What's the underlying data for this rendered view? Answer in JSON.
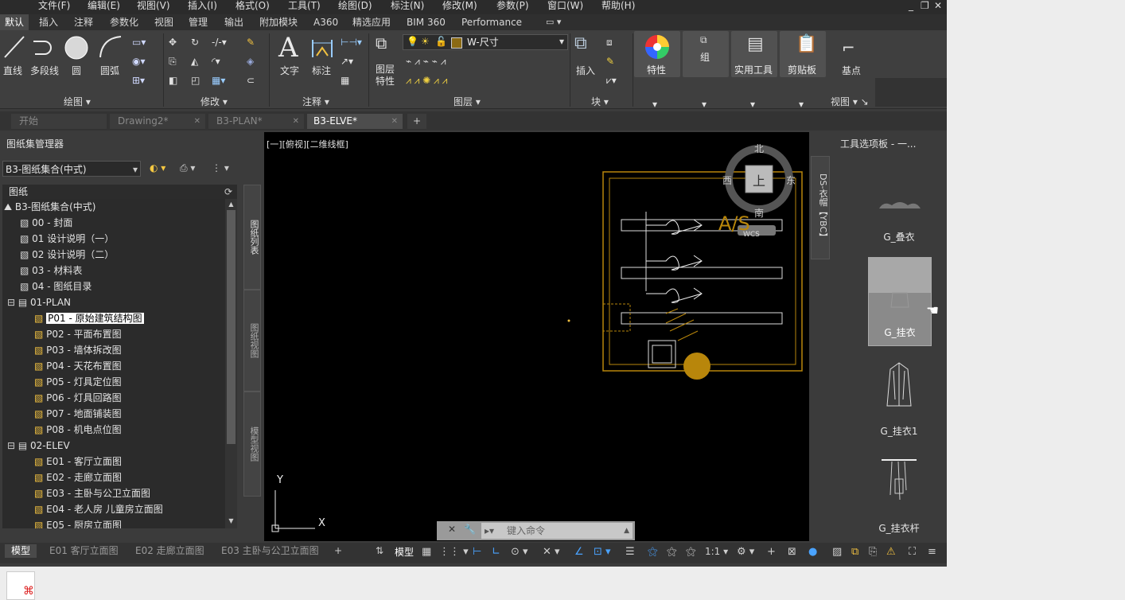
{
  "menubar": {
    "items": [
      "文件(F)",
      "编辑(E)",
      "视图(V)",
      "插入(I)",
      "格式(O)",
      "工具(T)",
      "绘图(D)",
      "标注(N)",
      "修改(M)",
      "参数(P)",
      "窗口(W)",
      "帮助(H)"
    ]
  },
  "window_controls": {
    "minimize": "_",
    "restore": "❐",
    "close": "✕"
  },
  "ribbon_tabs": [
    "默认",
    "插入",
    "注释",
    "参数化",
    "视图",
    "管理",
    "输出",
    "附加模块",
    "A360",
    "精选应用",
    "BIM 360",
    "Performance"
  ],
  "ribbon_tab_active": "默认",
  "ribbon": {
    "tools": {
      "line": "直线",
      "polyline": "多段线",
      "circle": "圆",
      "arc": "圆弧",
      "text": "文字",
      "dimension": "标注",
      "layer_props": "图层\n特性",
      "insert": "插入",
      "properties": "特性",
      "group": "组",
      "utilities": "实用工具",
      "clipboard": "剪贴板",
      "base": "基点"
    },
    "layer_current": "W-尺寸",
    "panels": [
      "绘图",
      "修改",
      "注释",
      "图层",
      "块",
      "视图"
    ]
  },
  "doc_tabs": [
    {
      "label": "开始"
    },
    {
      "label": "Drawing2*"
    },
    {
      "label": "B3-PLAN*"
    },
    {
      "label": "B3-ELVE*"
    }
  ],
  "doc_tab_active": "B3-ELVE*",
  "sheet_manager": {
    "title": "图纸集管理器",
    "combo_value": "B3-图纸集合(中式)",
    "header": "图纸",
    "tree": [
      {
        "label": "B3-图纸集合(中式)",
        "level": 0,
        "type": "root"
      },
      {
        "label": "00 - 封面",
        "level": 1,
        "type": "sheet"
      },
      {
        "label": "01 设计说明（一）",
        "level": 1,
        "type": "sheet"
      },
      {
        "label": "02 设计说明（二）",
        "level": 1,
        "type": "sheet"
      },
      {
        "label": "03 - 材料表",
        "level": 1,
        "type": "sheet"
      },
      {
        "label": "04 - 图纸目录",
        "level": 1,
        "type": "sheet"
      },
      {
        "label": "01-PLAN",
        "level": 1,
        "type": "group"
      },
      {
        "label": "P01 - 原始建筑结构图",
        "level": 2,
        "type": "sheet",
        "selected": true
      },
      {
        "label": "P02 - 平面布置图",
        "level": 2,
        "type": "sheet"
      },
      {
        "label": "P03 - 墙体拆改图",
        "level": 2,
        "type": "sheet"
      },
      {
        "label": "P04 - 天花布置图",
        "level": 2,
        "type": "sheet"
      },
      {
        "label": "P05 - 灯具定位图",
        "level": 2,
        "type": "sheet"
      },
      {
        "label": "P06 - 灯具回路图",
        "level": 2,
        "type": "sheet"
      },
      {
        "label": "P07 - 地面铺装图",
        "level": 2,
        "type": "sheet"
      },
      {
        "label": "P08 - 机电点位图",
        "level": 2,
        "type": "sheet"
      },
      {
        "label": "02-ELEV",
        "level": 1,
        "type": "group"
      },
      {
        "label": "E01 - 客厅立面图",
        "level": 2,
        "type": "sheet"
      },
      {
        "label": "E02 - 走廊立面图",
        "level": 2,
        "type": "sheet"
      },
      {
        "label": "E03 - 主卧与公卫立面图",
        "level": 2,
        "type": "sheet"
      },
      {
        "label": "E04 - 老人房 儿童房立面图",
        "level": 2,
        "type": "sheet"
      },
      {
        "label": "E05 - 厨房立面图",
        "level": 2,
        "type": "sheet"
      }
    ],
    "side_tabs": [
      "图纸列表",
      "图纸视图",
      "模型视图"
    ]
  },
  "viewport": {
    "label": "[一][俯视][二维线框]",
    "compass": {
      "north": "北",
      "south": "南",
      "east": "东",
      "west": "西",
      "top": "上",
      "wcs": "WCS"
    },
    "drawing_text": "A/S",
    "ucs": {
      "x": "X",
      "y": "Y"
    }
  },
  "command_line": {
    "placeholder": "键入命令"
  },
  "right_strip": {
    "label": "DS-衣帽【YBC】"
  },
  "tool_palette": {
    "title": "工具选项板 - 一...",
    "items": [
      "G_叠衣",
      "G_挂衣",
      "G_挂衣1",
      "G_挂衣杆"
    ]
  },
  "layout_tabs": [
    "模型",
    "E01 客厅立面图",
    "E02 走廊立面图",
    "E03 主卧与公卫立面图"
  ],
  "layout_tab_active": "模型",
  "status": {
    "model": "模型",
    "scale": "1:1"
  },
  "colors": {
    "accent": "#b8860b",
    "drawing": "#e8e8e8",
    "background": "#000000"
  }
}
